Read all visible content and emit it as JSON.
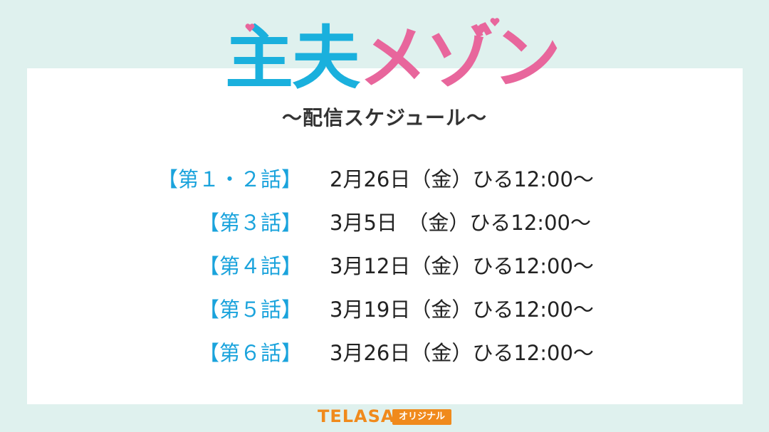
{
  "logo": {
    "part_blue": "主夫",
    "part_pink": "メゾン",
    "icon": "heart-icon"
  },
  "subtitle": "〜配信スケジュール〜",
  "schedule": [
    {
      "episode": "【第１・２話】",
      "date": "2月26日（金）ひる12:00〜"
    },
    {
      "episode": "【第３話】",
      "date": "3月5日　（金）ひる12:00〜"
    },
    {
      "episode": "【第４話】",
      "date": "3月12日（金）ひる12:00〜"
    },
    {
      "episode": "【第５話】",
      "date": "3月19日（金）ひる12:00〜"
    },
    {
      "episode": "【第６話】",
      "date": "3月26日（金）ひる12:00〜"
    }
  ],
  "brand": {
    "name": "TELASA",
    "badge": "オリジナル"
  },
  "colors": {
    "background": "#dff1ee",
    "accent_blue": "#1ab0dd",
    "accent_pink": "#e8669c",
    "brand_orange": "#f08a1c"
  }
}
